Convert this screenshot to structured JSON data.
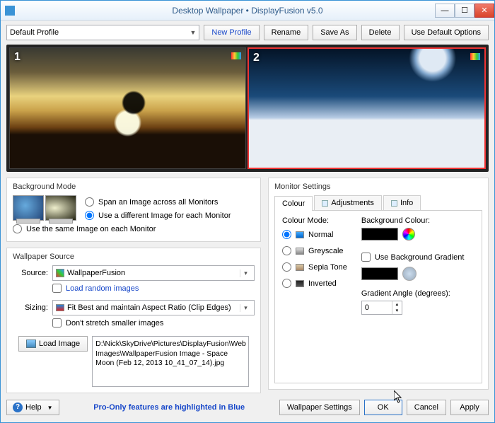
{
  "window": {
    "title": "Desktop Wallpaper • DisplayFusion v5.0"
  },
  "toolbar": {
    "profile": "Default Profile",
    "new_profile": "New Profile",
    "rename": "Rename",
    "save_as": "Save As",
    "delete": "Delete",
    "use_default": "Use Default Options"
  },
  "monitors": [
    {
      "number": "1"
    },
    {
      "number": "2"
    }
  ],
  "bgmode": {
    "legend": "Background Mode",
    "opt_span": "Span an Image across all Monitors",
    "opt_diff": "Use a different Image for each Monitor",
    "opt_same": "Use the same Image on each Monitor"
  },
  "source": {
    "legend": "Wallpaper Source",
    "label_source": "Source:",
    "source_value": "WallpaperFusion",
    "chk_random": "Load random images",
    "label_sizing": "Sizing:",
    "sizing_value": "Fit Best and maintain Aspect Ratio (Clip Edges)",
    "chk_nostretch": "Don't stretch smaller images",
    "load_image": "Load Image",
    "path": "D:\\Nick\\SkyDrive\\Pictures\\DisplayFusion\\Web Images\\WallpaperFusion Image - Space Moon (Feb 12, 2013 10_41_07_14).jpg"
  },
  "monitor_settings": {
    "legend": "Monitor Settings",
    "tab_colour": "Colour",
    "tab_adjustments": "Adjustments",
    "tab_info": "Info",
    "colour_mode_label": "Colour Mode:",
    "opt_normal": "Normal",
    "opt_greyscale": "Greyscale",
    "opt_sepia": "Sepia Tone",
    "opt_inverted": "Inverted",
    "bg_colour_label": "Background Colour:",
    "chk_gradient": "Use Background Gradient",
    "gradient_label": "Gradient Angle (degrees):",
    "gradient_value": "0"
  },
  "footer": {
    "help": "Help",
    "promo": "Pro-Only features are highlighted in Blue",
    "wallpaper_settings": "Wallpaper Settings",
    "ok": "OK",
    "cancel": "Cancel",
    "apply": "Apply"
  }
}
